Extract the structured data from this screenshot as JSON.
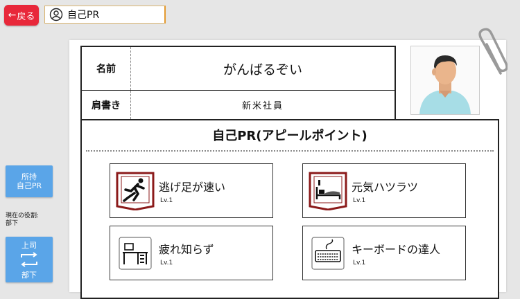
{
  "header": {
    "back_label": "戻る",
    "title": "自己PR"
  },
  "profile": {
    "name_label": "名前",
    "name_value": "がんばるぞい",
    "title_label": "肩書き",
    "title_value": "新米社員"
  },
  "pr": {
    "heading": "自己PR(アピールポイント)",
    "skills": [
      {
        "name": "逃げ足が速い",
        "level": "Lv.1",
        "icon": "running-person-icon"
      },
      {
        "name": "元気ハツラツ",
        "level": "Lv.1",
        "icon": "bed-icon"
      },
      {
        "name": "疲れ知らず",
        "level": "Lv.1",
        "icon": "desk-icon"
      },
      {
        "name": "キーボードの達人",
        "level": "Lv.1",
        "icon": "keyboard-icon"
      }
    ]
  },
  "sidebar": {
    "own_pr_label": "所持\n自己PR",
    "role_caption": "現在の役割:",
    "role_value": "部下",
    "swap_top": "上司",
    "swap_bottom": "部下"
  },
  "colors": {
    "back_button": "#e8283a",
    "side_button": "#5aa5e8",
    "icon_frame": "#8b1a1a"
  }
}
